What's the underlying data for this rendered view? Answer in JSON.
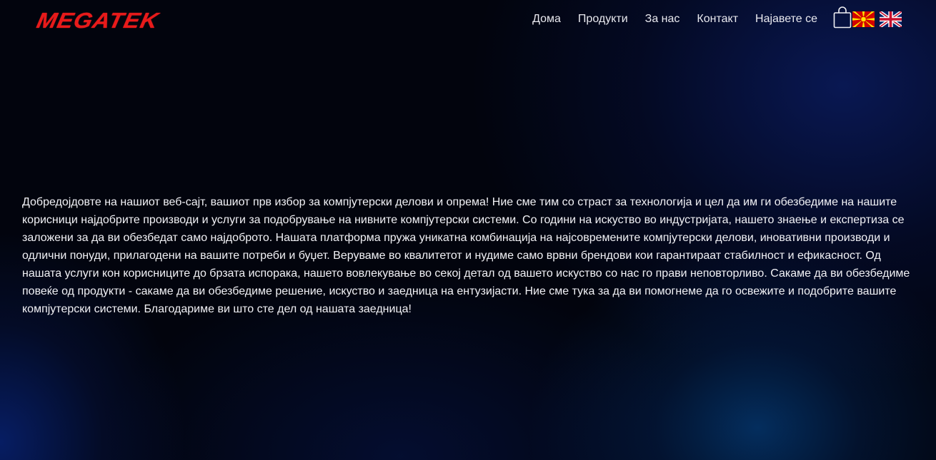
{
  "header": {
    "logo_text": "MEGATEK",
    "nav": [
      {
        "label": "Дома"
      },
      {
        "label": "Продукти"
      },
      {
        "label": "За нас"
      },
      {
        "label": "Контакт"
      },
      {
        "label": "Најавете се"
      }
    ],
    "icons": {
      "cart": "shopping-bag-icon",
      "language_mk": "macedonia-flag-icon",
      "language_en": "uk-flag-icon"
    }
  },
  "main": {
    "welcome_text": "Добредојдовте на нашиот веб-сајт, вашиот прв избор за компјутерски делови и опрема! Ние сме тим со страст за технологија и цел да им ги обезбедиме на нашите корисници најдобрите производи и услуги за подобрување на нивните компјутерски системи. Со години на искуство во индустријата, нашето знаење и експертиза се заложени за да ви обезбедат само најдоброто. Нашата платформа пружа уникатна комбинација на најсовремените компјутерски делови, иновативни производи и одлични понуди, прилагодени на вашите потреби и буџет. Веруваме во квалитетот и нудиме само врвни брендови кои гарантираат стабилност и ефикасност. Од нашата услуги кон корисниците до брзата испорака, нашето вовлекување во секој детал од вашето искуство со нас го прави неповторливо. Сакаме да ви обезбедиме повеќе од продукти - сакаме да ви обезбедиме решение, искуство и заедница на ентузијасти. Ние сме тука за да ви помогнеме да го освежите и подобрите вашите компјутерски системи. Благодариме ви што сте дел од нашата заедница!"
  },
  "colors": {
    "logo": "#e81a1a",
    "background": "#02040d",
    "glow": "#0a3a9a",
    "text": "#f2f2f6"
  }
}
